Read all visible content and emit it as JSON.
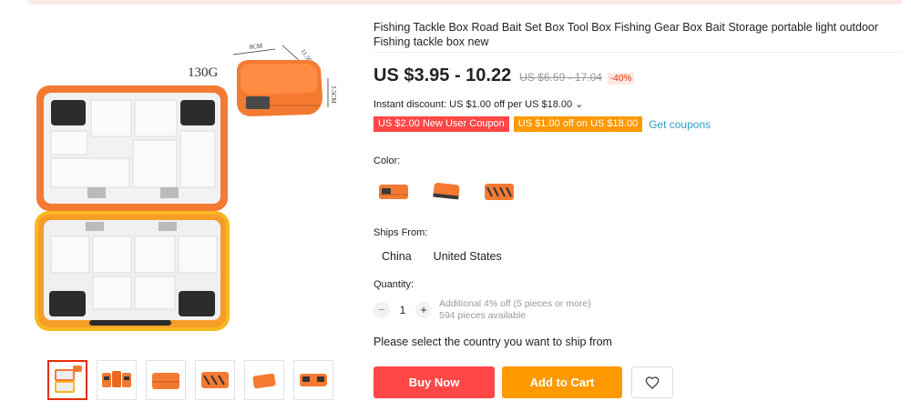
{
  "product": {
    "title": "Fishing Tackle Box Road Bait Set Box Tool Box Fishing Gear Box Bait Storage portable light outdoor Fishing tackle box new",
    "image_annotations": {
      "weight": "130G",
      "width": "8CM",
      "length": "11.5CM",
      "height": "3.5CM"
    }
  },
  "price": {
    "current": "US $3.95 - 10.22",
    "original": "US $6.59 - 17.04",
    "discount": "-40%"
  },
  "promo": {
    "instant_discount": "Instant discount: US $1.00 off per US $18.00 ⌄",
    "coupon_new_user": "US $2.00 New User Coupon",
    "coupon_store": "US $1.00 off on US $18.00",
    "get_coupons": "Get coupons"
  },
  "color": {
    "label": "Color:",
    "options": [
      "orange-box-small",
      "orange-box-closed",
      "orange-box-patterned"
    ]
  },
  "shipping": {
    "label": "Ships From:",
    "options": [
      "China",
      "United States"
    ]
  },
  "quantity": {
    "label": "Quantity:",
    "minus": "−",
    "plus": "+",
    "value": "1",
    "note_discount": "Additional 4% off (5 pieces or more)",
    "note_available": "594 pieces available"
  },
  "select_country_msg": "Please select the country you want to ship from",
  "actions": {
    "buy_now": "Buy Now",
    "add_to_cart": "Add to Cart",
    "wishlist_icon": "heart-icon"
  },
  "colors": {
    "accent_red": "#ff4747",
    "accent_orange": "#ff9900",
    "link_blue": "#2e9cc3",
    "product_orange": "#f47a32"
  }
}
